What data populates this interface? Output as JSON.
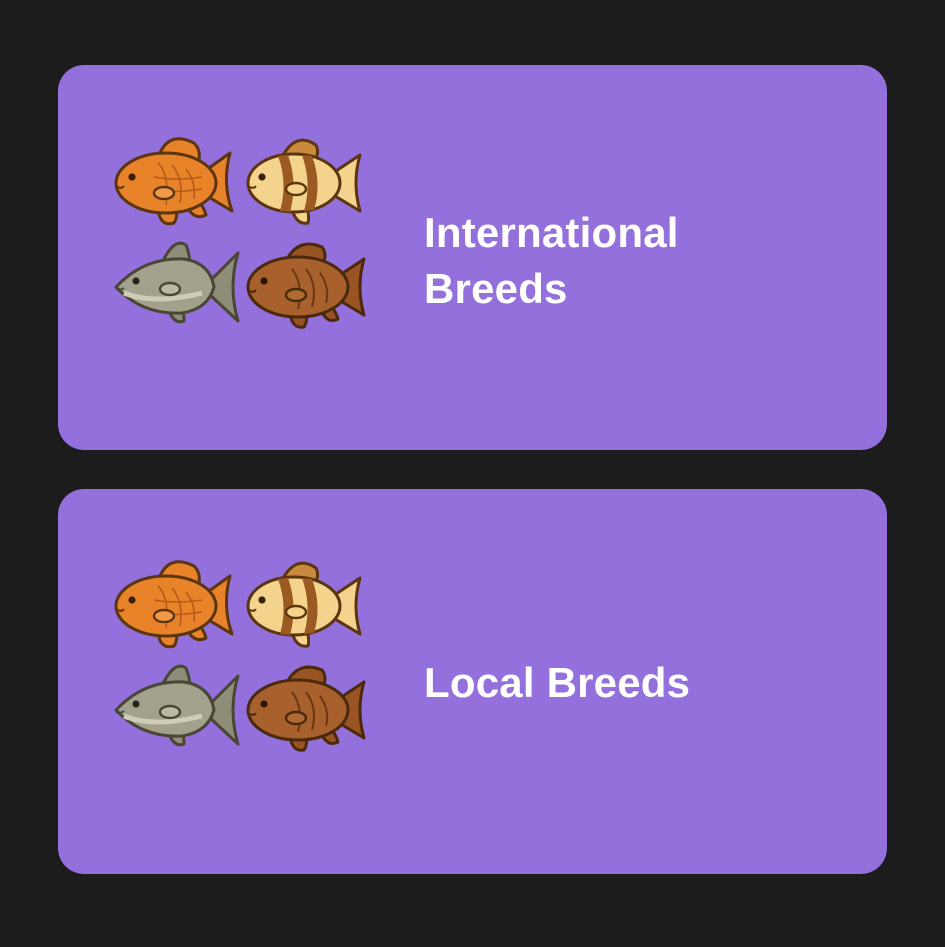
{
  "cards": [
    {
      "label": "International Breeds",
      "icon": "fish-group-icon"
    },
    {
      "label": "Local Breeds",
      "icon": "fish-group-icon"
    }
  ],
  "colors": {
    "background": "#1c1c1c",
    "card": "#9370db",
    "text": "#ffffff",
    "goldfish": "#e8832a",
    "clownfish_body": "#f4d48c",
    "clownfish_stripe": "#9a5a22",
    "tuna": "#8f8d78",
    "brown_fish": "#9a5424",
    "outline": "#5a3510"
  }
}
